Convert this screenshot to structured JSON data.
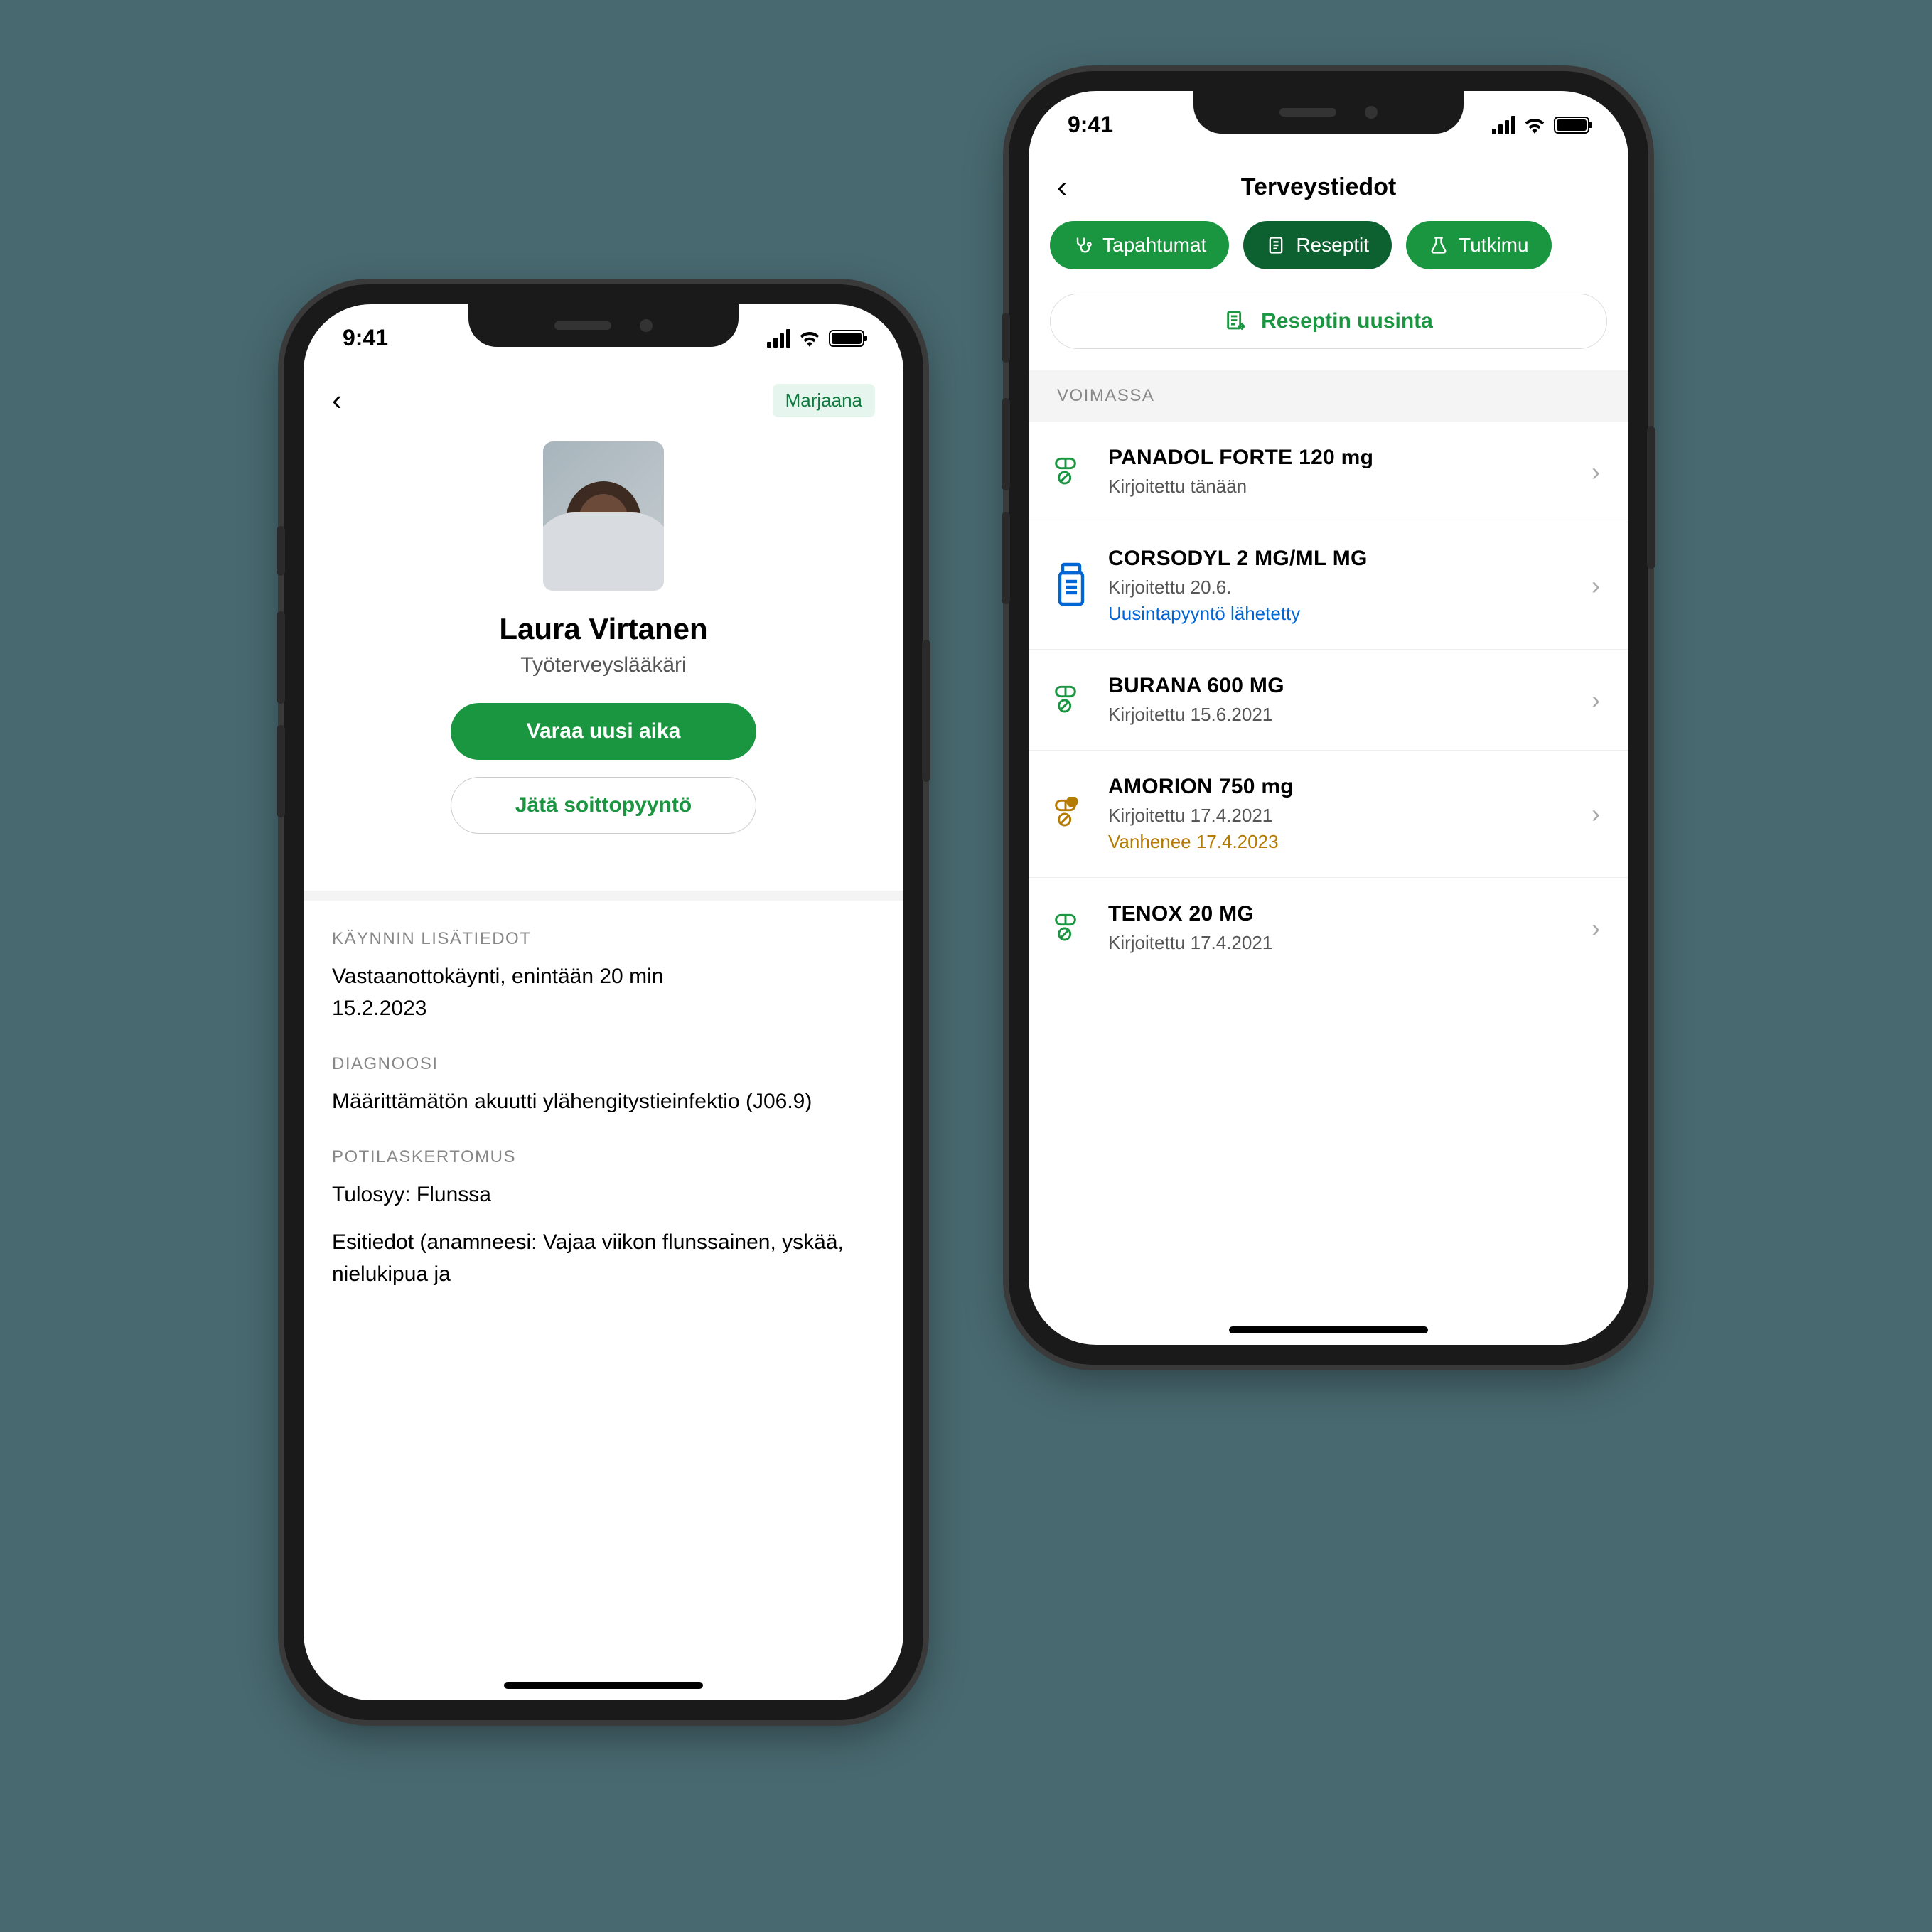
{
  "status_time": "9:41",
  "left": {
    "user_badge": "Marjaana",
    "doctor_name": "Laura Virtanen",
    "doctor_title": "Työterveyslääkäri",
    "btn_book": "Varaa uusi aika",
    "btn_callback": "Jätä soittopyyntö",
    "section1_label": "KÄYNNIN LISÄTIEDOT",
    "section1_text1": "Vastaanottokäynti, enintään 20 min",
    "section1_text2": "15.2.2023",
    "section2_label": "DIAGNOOSI",
    "section2_text": "Määrittämätön akuutti ylähengitystieinfektio (J06.9)",
    "section3_label": "POTILASKERTOMUS",
    "section3_text1": "Tulosyy: Flunssa",
    "section3_text2": "Esitiedot (anamneesi: Vajaa viikon flunssainen, yskää, nielukipua ja"
  },
  "right": {
    "nav_title": "Terveystiedot",
    "chip1": "Tapahtumat",
    "chip2": "Reseptit",
    "chip3": "Tutkimu",
    "renew_label": "Reseptin uusinta",
    "group_header": "VOIMASSA",
    "rx": [
      {
        "name": "PANADOL FORTE 120 mg",
        "sub": "Kirjoitettu tänään",
        "status": "",
        "status_cls": "",
        "icon": "pill-green"
      },
      {
        "name": "CORSODYL 2 MG/ML MG",
        "sub": "Kirjoitettu 20.6.",
        "status": "Uusintapyyntö lähetetty",
        "status_cls": "blue",
        "icon": "bottle-blue"
      },
      {
        "name": "BURANA 600 MG",
        "sub": "Kirjoitettu 15.6.2021",
        "status": "",
        "status_cls": "",
        "icon": "pill-green"
      },
      {
        "name": "AMORION 750 mg",
        "sub": "Kirjoitettu 17.4.2021",
        "status": "Vanhenee 17.4.2023",
        "status_cls": "amber",
        "icon": "pill-amber"
      },
      {
        "name": "TENOX 20 MG",
        "sub": "Kirjoitettu 17.4.2021",
        "status": "",
        "status_cls": "",
        "icon": "pill-green"
      }
    ]
  }
}
